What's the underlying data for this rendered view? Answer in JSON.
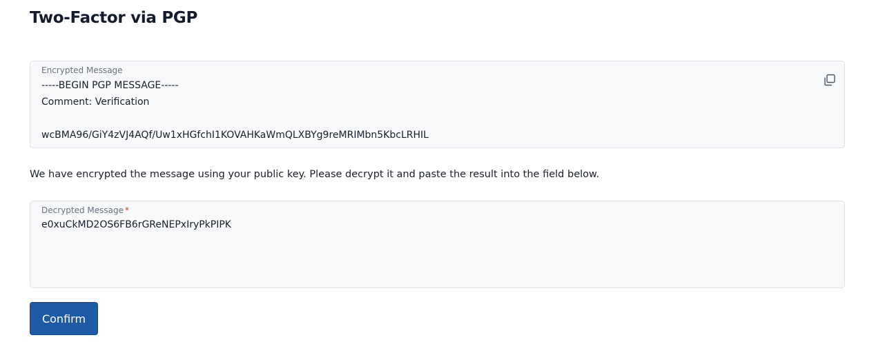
{
  "page": {
    "title": "Two-Factor via PGP",
    "instructions": "We have encrypted the message using your public key. Please decrypt it and paste the result into the field below."
  },
  "encrypted_field": {
    "label": "Encrypted Message",
    "value": "-----BEGIN PGP MESSAGE-----\nComment: Verification\n\nwcBMA96/GiY4zVJ4AQf/Uw1xHGfchI1KOVAHKaWmQLXBYg9reMRIMbn5KbcLRHIL",
    "copy_icon": "copy-icon"
  },
  "decrypted_field": {
    "label": "Decrypted Message",
    "required_marker": "*",
    "value": "e0xuCkMD2OS6FB6rGReNEPxIryPkPIPK"
  },
  "actions": {
    "confirm_label": "Confirm"
  },
  "colors": {
    "primary": "#1f5aa6",
    "field_background": "#f7f8fa",
    "field_border": "#dde1e7",
    "required": "#d92d20"
  }
}
